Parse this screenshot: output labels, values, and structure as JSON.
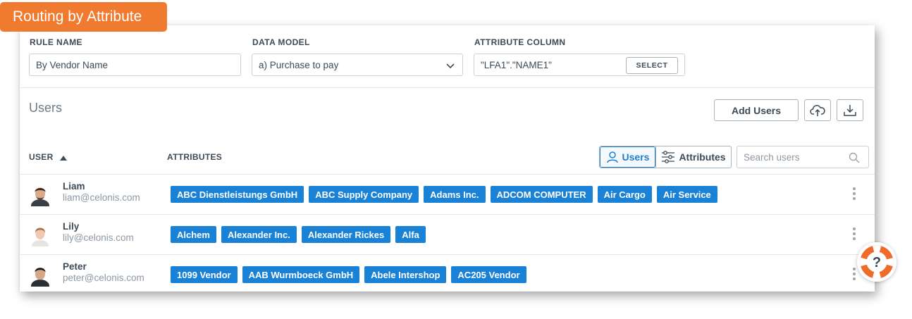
{
  "header_badge": "Routing by Attribute",
  "form": {
    "rule_name_label": "RULE NAME",
    "rule_name_value": "By Vendor Name",
    "data_model_label": "DATA MODEL",
    "data_model_value": "a) Purchase to pay",
    "attribute_column_label": "ATTRIBUTE COLUMN",
    "attribute_column_value": "\"LFA1\".\"NAME1\"",
    "select_button": "SELECT"
  },
  "users_section": {
    "title": "Users",
    "add_users_button": "Add Users",
    "upload_icon": "cloud-upload-icon",
    "download_icon": "download-icon",
    "columns": {
      "user": "USER",
      "attributes": "ATTRIBUTES"
    },
    "toggle": {
      "users": "Users",
      "attributes": "Attributes",
      "active": "users"
    },
    "search_placeholder": "Search users",
    "rows": [
      {
        "name": "Liam",
        "email": "liam@celonis.com",
        "tags": [
          "ABC Dienstleistungs GmbH",
          "ABC Supply Company",
          "Adams Inc.",
          "ADCOM COMPUTER",
          "Air Cargo",
          "Air Service"
        ]
      },
      {
        "name": "Lily",
        "email": "lily@celonis.com",
        "tags": [
          "Alchem",
          "Alexander Inc.",
          "Alexander Rickes",
          "Alfa"
        ]
      },
      {
        "name": "Peter",
        "email": "peter@celonis.com",
        "tags": [
          "1099 Vendor",
          "AAB Wurmboeck GmbH",
          "Abele Intershop",
          "AC205 Vendor"
        ]
      }
    ]
  },
  "colors": {
    "accent": "#1a82d6",
    "badge": "#ef7a30",
    "help_ring": "#f06a2a"
  }
}
